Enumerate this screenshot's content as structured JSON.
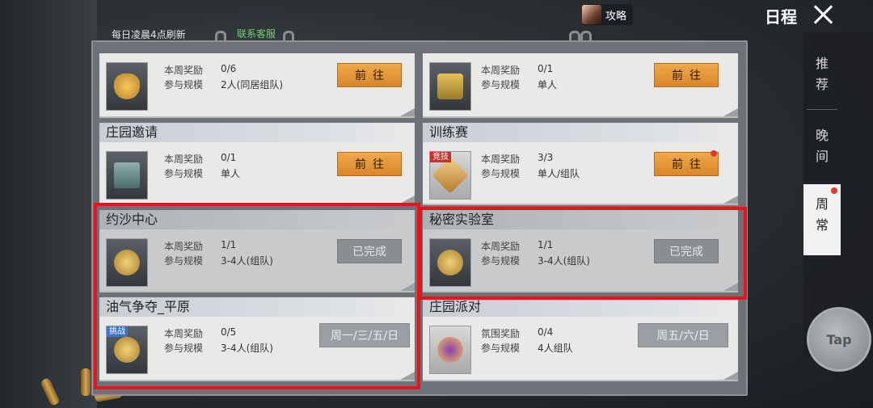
{
  "header": {
    "refresh_note": "每日凌晨4点刷新",
    "contact_label": "联系客服",
    "guide_label": "攻略",
    "title": "日程"
  },
  "sidebar": {
    "tabs": [
      {
        "label": "推荐",
        "active": false
      },
      {
        "label": "晚间",
        "active": false
      },
      {
        "label": "周常",
        "active": true,
        "has_red_dot": true
      }
    ]
  },
  "floating_button": {
    "label": "Tap"
  },
  "labels": {
    "reward": "本周奖励",
    "scale": "参与规模",
    "ambience_reward": "氛围奖励"
  },
  "cards": [
    {
      "title": "",
      "reward": "0/6",
      "scale": "2人(同居组队)",
      "button": "前往",
      "icon": "heart-gift-icon"
    },
    {
      "title": "",
      "reward": "0/1",
      "scale": "单人",
      "button": "前往",
      "icon": "treasure-chest-icon"
    },
    {
      "title": "庄园邀请",
      "reward": "0/1",
      "scale": "单人",
      "button": "前往",
      "icon": "crate-icon"
    },
    {
      "title": "训练赛",
      "reward": "3/3",
      "scale": "单人/组队",
      "button": "前往",
      "icon": "medal-icon",
      "tag": "竞技",
      "has_red_dot": true
    },
    {
      "title": "约沙中心",
      "reward": "1/1",
      "scale": "3-4人(组队)",
      "button": "已完成",
      "icon": "coin-icon"
    },
    {
      "title": "秘密实验室",
      "reward": "1/1",
      "scale": "3-4人(组队)",
      "button": "已完成",
      "icon": "coin-icon"
    },
    {
      "title": "油气争夺_平原",
      "reward": "0/5",
      "scale": "3-4人(组队)",
      "button": "周一/三/五/日",
      "icon": "coin-icon",
      "tag": "挑战"
    },
    {
      "title": "庄园派对",
      "reward": "0/4",
      "scale": "4人组队",
      "button": "周五/六/日",
      "icon": "party-icon"
    }
  ],
  "colors": {
    "highlight": "#e8141c",
    "go_button": "#e89a3c",
    "red_dot": "#e0392d"
  }
}
